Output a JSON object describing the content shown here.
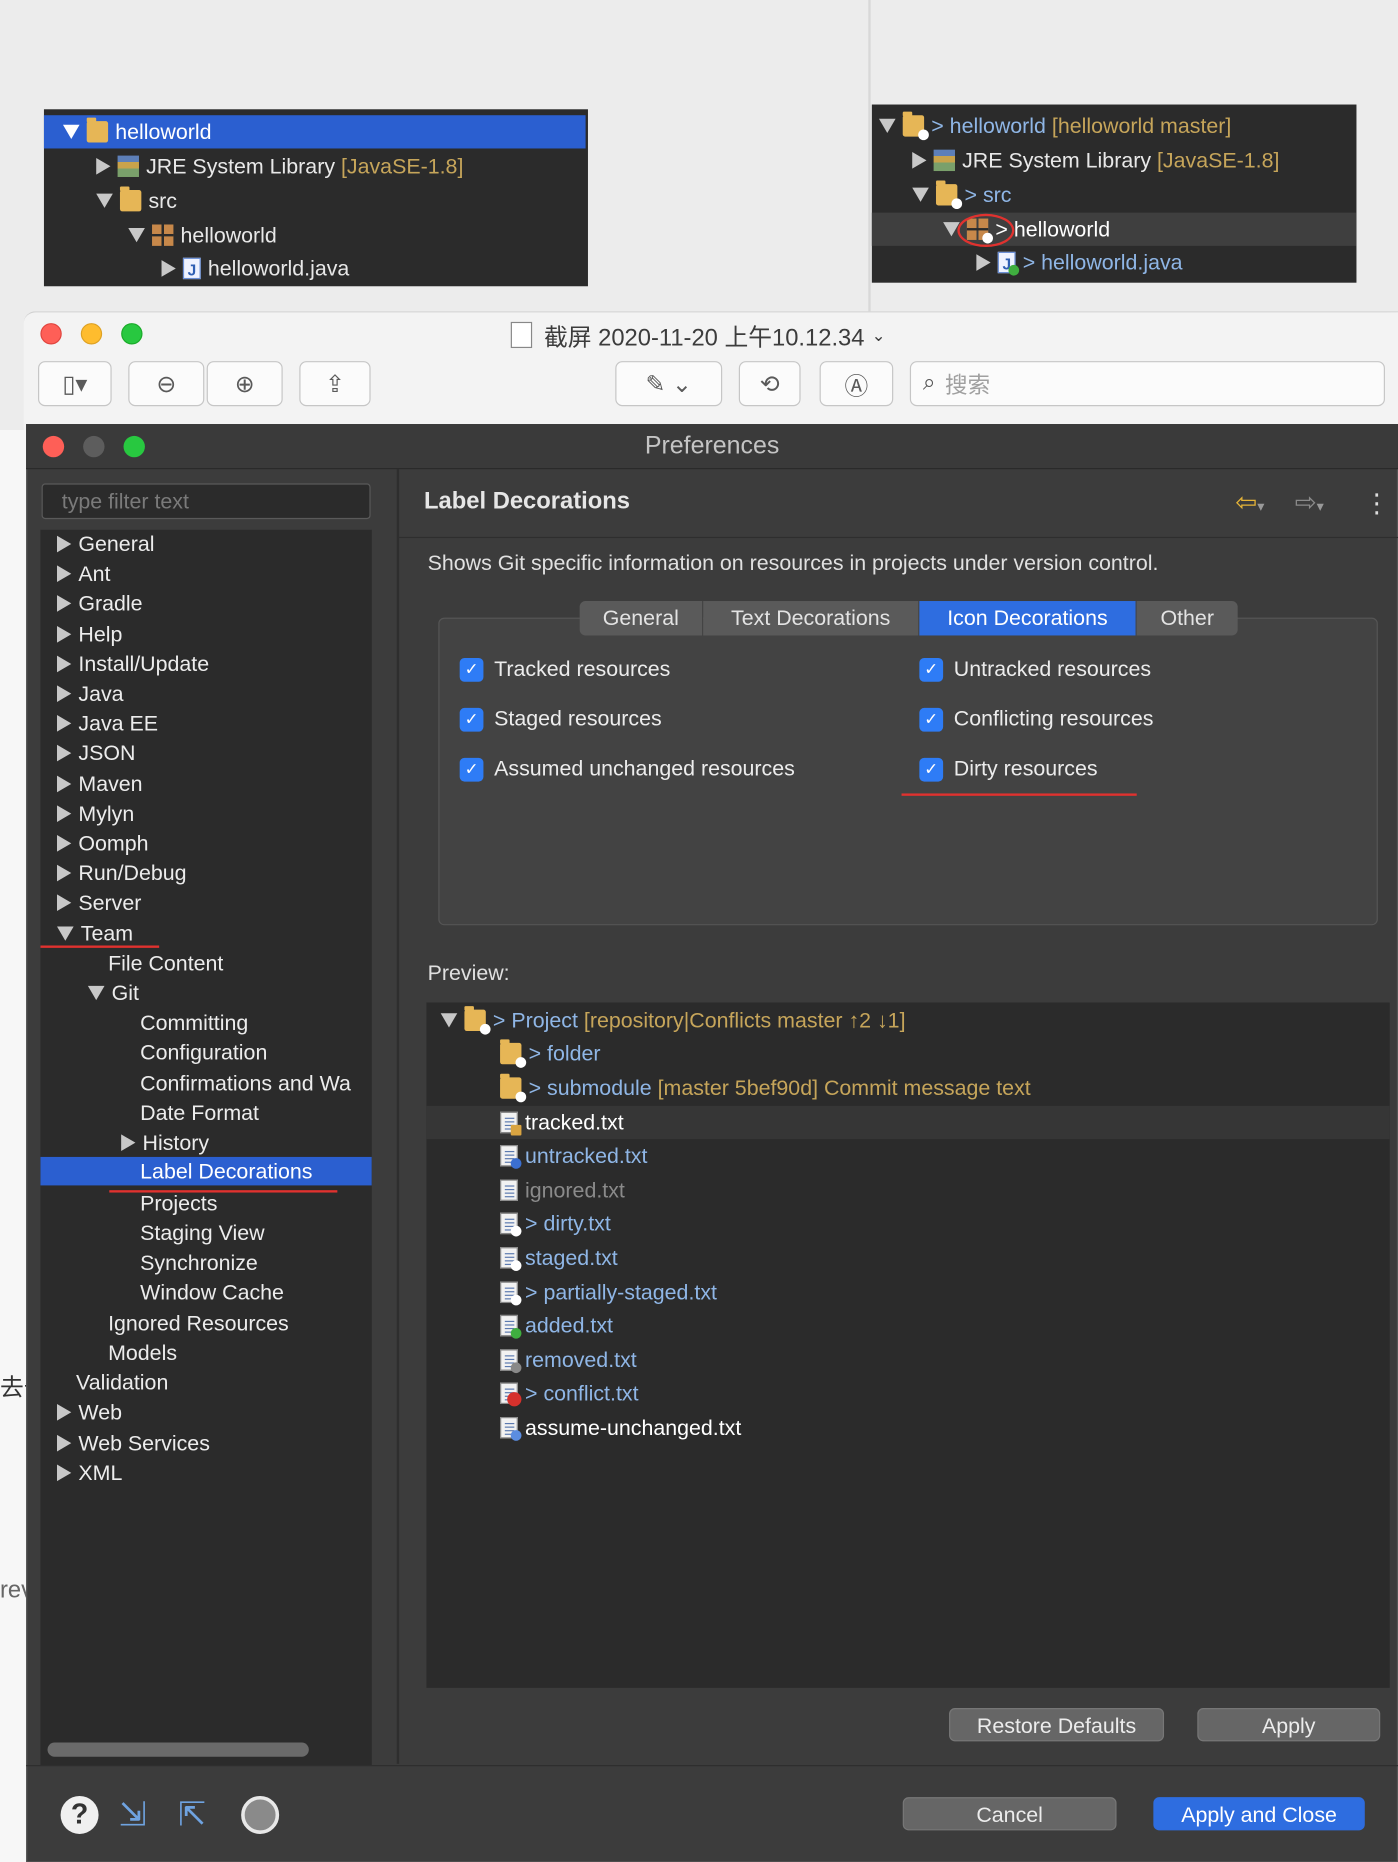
{
  "top_left_tree": {
    "items": [
      {
        "label": "helloworld"
      },
      {
        "label": "JRE System Library",
        "suffix": "[JavaSE-1.8]"
      },
      {
        "label": "src"
      },
      {
        "label": "helloworld"
      },
      {
        "label": "helloworld.java"
      }
    ]
  },
  "top_right_tree": {
    "items": [
      {
        "prefix": ">",
        "label": "helloworld",
        "suffix": "[helloworld master]"
      },
      {
        "label": "JRE System Library",
        "suffix": "[JavaSE-1.8]"
      },
      {
        "prefix": ">",
        "label": "src"
      },
      {
        "prefix": ">",
        "label": "helloworld"
      },
      {
        "prefix": ">",
        "label": "helloworld.java"
      }
    ]
  },
  "preview_window": {
    "title": "截屏 2020-11-20 上午10.12.34",
    "search_placeholder": "搜索"
  },
  "preferences": {
    "title": "Preferences",
    "filter_placeholder": "type filter text",
    "page_title": "Label Decorations",
    "description": "Shows Git specific information on resources in projects under version control.",
    "tabs": [
      "General",
      "Text Decorations",
      "Icon Decorations",
      "Other"
    ],
    "active_tab": "Icon Decorations",
    "checkboxes": {
      "tracked": "Tracked resources",
      "untracked": "Untracked resources",
      "staged": "Staged resources",
      "conflicting": "Conflicting resources",
      "assumed": "Assumed unchanged resources",
      "dirty": "Dirty resources"
    },
    "preview_label": "Preview:",
    "preview_tree": {
      "project": {
        "prefix": ">",
        "label": "Project",
        "suffix": "[repository|Conflicts master ↑2 ↓1]"
      },
      "folder": {
        "prefix": ">",
        "label": "folder"
      },
      "submodule": {
        "prefix": ">",
        "label": "submodule",
        "suffix": "[master 5bef90d] Commit message text"
      },
      "tracked": "tracked.txt",
      "untracked": "untracked.txt",
      "ignored": "ignored.txt",
      "dirty": {
        "prefix": ">",
        "label": "dirty.txt"
      },
      "staged": "staged.txt",
      "partially": {
        "prefix": ">",
        "label": "partially-staged.txt"
      },
      "added": "added.txt",
      "removed": "removed.txt",
      "conflict": {
        "prefix": ">",
        "label": "conflict.txt"
      },
      "assume": "assume-unchanged.txt"
    },
    "sidebar": {
      "general": "General",
      "ant": "Ant",
      "gradle": "Gradle",
      "help": "Help",
      "install": "Install/Update",
      "java": "Java",
      "javaee": "Java EE",
      "json": "JSON",
      "maven": "Maven",
      "mylyn": "Mylyn",
      "oomph": "Oomph",
      "rundebug": "Run/Debug",
      "server": "Server",
      "team": "Team",
      "filecontent": "File Content",
      "git": "Git",
      "committing": "Committing",
      "configuration": "Configuration",
      "confirmations": "Confirmations and Wa",
      "dateformat": "Date Format",
      "history": "History",
      "labeldec": "Label Decorations",
      "projects": "Projects",
      "staging": "Staging View",
      "synchronize": "Synchronize",
      "windowcache": "Window Cache",
      "ignored": "Ignored Resources",
      "models": "Models",
      "validation": "Validation",
      "web": "Web",
      "webservices": "Web Services",
      "xml": "XML"
    },
    "buttons": {
      "restore": "Restore Defaults",
      "apply": "Apply",
      "cancel": "Cancel",
      "apply_close": "Apply and Close"
    }
  },
  "background_fragments": {
    "char1": "去奇",
    "char2": "rev"
  },
  "colors": {
    "accent": "#2e7cf6",
    "selection": "#2b5fd0",
    "red_mark": "#e0322f"
  }
}
